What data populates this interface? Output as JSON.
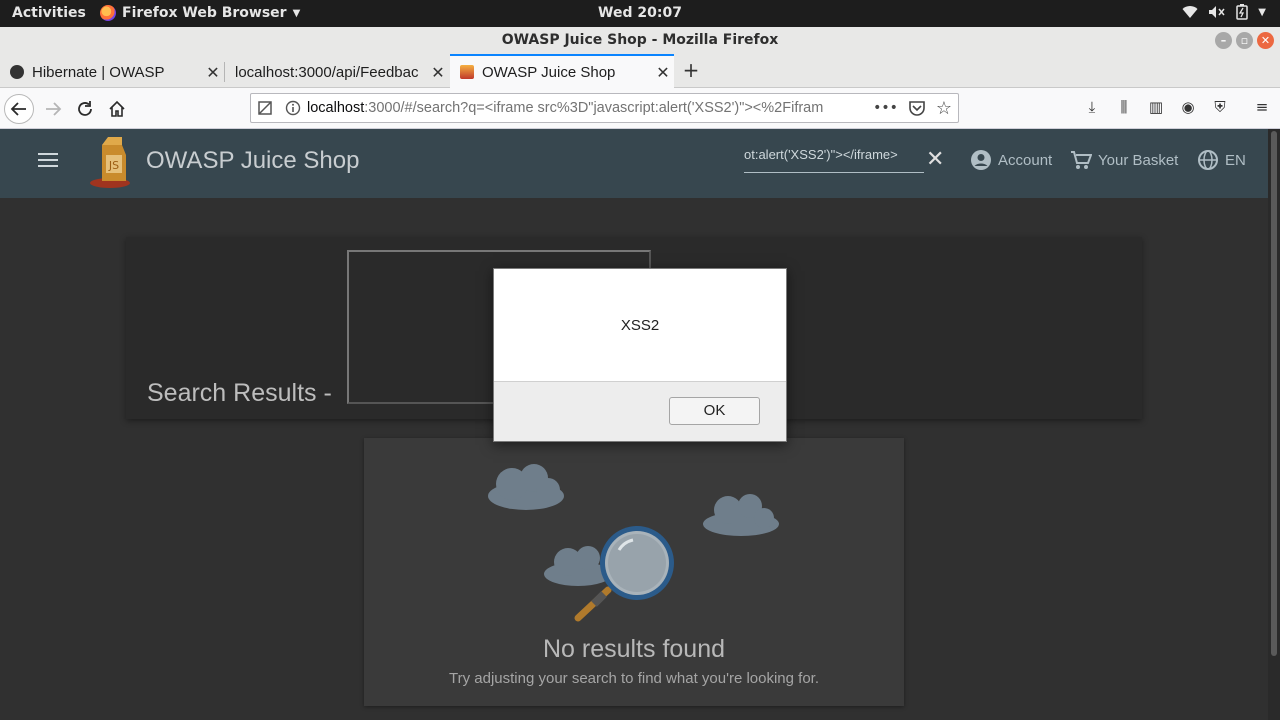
{
  "system_bar": {
    "activities": "Activities",
    "app_menu": "Firefox Web Browser",
    "clock": "Wed 20:07"
  },
  "window": {
    "title": "OWASP Juice Shop - Mozilla Firefox"
  },
  "tabs": [
    {
      "label": "Hibernate | OWASP",
      "active": false
    },
    {
      "label": "localhost:3000/api/Feedbac",
      "active": false
    },
    {
      "label": "OWASP Juice Shop",
      "active": true
    }
  ],
  "url": {
    "host": "localhost",
    "path": ":3000/#/search?q=<iframe src%3D\"javascript:alert('XSS2')\"><%2Fifram"
  },
  "app": {
    "title": "OWASP Juice Shop",
    "search_value": "ot:alert('XSS2')\"></iframe>",
    "account_label": "Account",
    "basket_label": "Your Basket",
    "language_label": "EN",
    "results_heading": "Search Results -",
    "no_results_title": "No results found",
    "no_results_sub": "Try adjusting your search to find what you're looking for.",
    "toolbar_color": "#37474f"
  },
  "alert": {
    "message": "XSS2",
    "ok_label": "OK"
  }
}
